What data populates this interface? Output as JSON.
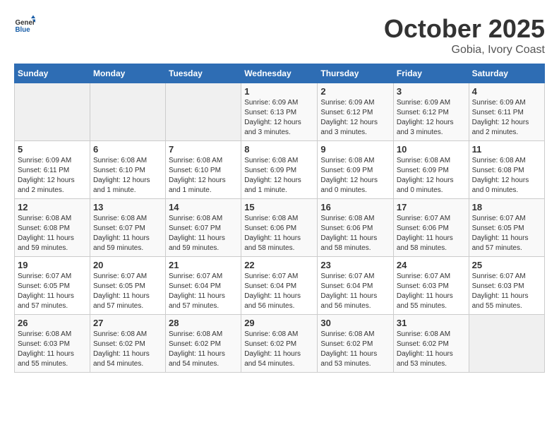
{
  "header": {
    "logo_general": "General",
    "logo_blue": "Blue",
    "month": "October 2025",
    "location": "Gobia, Ivory Coast"
  },
  "weekdays": [
    "Sunday",
    "Monday",
    "Tuesday",
    "Wednesday",
    "Thursday",
    "Friday",
    "Saturday"
  ],
  "weeks": [
    [
      {
        "day": "",
        "info": ""
      },
      {
        "day": "",
        "info": ""
      },
      {
        "day": "",
        "info": ""
      },
      {
        "day": "1",
        "info": "Sunrise: 6:09 AM\nSunset: 6:13 PM\nDaylight: 12 hours\nand 3 minutes."
      },
      {
        "day": "2",
        "info": "Sunrise: 6:09 AM\nSunset: 6:12 PM\nDaylight: 12 hours\nand 3 minutes."
      },
      {
        "day": "3",
        "info": "Sunrise: 6:09 AM\nSunset: 6:12 PM\nDaylight: 12 hours\nand 3 minutes."
      },
      {
        "day": "4",
        "info": "Sunrise: 6:09 AM\nSunset: 6:11 PM\nDaylight: 12 hours\nand 2 minutes."
      }
    ],
    [
      {
        "day": "5",
        "info": "Sunrise: 6:09 AM\nSunset: 6:11 PM\nDaylight: 12 hours\nand 2 minutes."
      },
      {
        "day": "6",
        "info": "Sunrise: 6:08 AM\nSunset: 6:10 PM\nDaylight: 12 hours\nand 1 minute."
      },
      {
        "day": "7",
        "info": "Sunrise: 6:08 AM\nSunset: 6:10 PM\nDaylight: 12 hours\nand 1 minute."
      },
      {
        "day": "8",
        "info": "Sunrise: 6:08 AM\nSunset: 6:09 PM\nDaylight: 12 hours\nand 1 minute."
      },
      {
        "day": "9",
        "info": "Sunrise: 6:08 AM\nSunset: 6:09 PM\nDaylight: 12 hours\nand 0 minutes."
      },
      {
        "day": "10",
        "info": "Sunrise: 6:08 AM\nSunset: 6:09 PM\nDaylight: 12 hours\nand 0 minutes."
      },
      {
        "day": "11",
        "info": "Sunrise: 6:08 AM\nSunset: 6:08 PM\nDaylight: 12 hours\nand 0 minutes."
      }
    ],
    [
      {
        "day": "12",
        "info": "Sunrise: 6:08 AM\nSunset: 6:08 PM\nDaylight: 11 hours\nand 59 minutes."
      },
      {
        "day": "13",
        "info": "Sunrise: 6:08 AM\nSunset: 6:07 PM\nDaylight: 11 hours\nand 59 minutes."
      },
      {
        "day": "14",
        "info": "Sunrise: 6:08 AM\nSunset: 6:07 PM\nDaylight: 11 hours\nand 59 minutes."
      },
      {
        "day": "15",
        "info": "Sunrise: 6:08 AM\nSunset: 6:06 PM\nDaylight: 11 hours\nand 58 minutes."
      },
      {
        "day": "16",
        "info": "Sunrise: 6:08 AM\nSunset: 6:06 PM\nDaylight: 11 hours\nand 58 minutes."
      },
      {
        "day": "17",
        "info": "Sunrise: 6:07 AM\nSunset: 6:06 PM\nDaylight: 11 hours\nand 58 minutes."
      },
      {
        "day": "18",
        "info": "Sunrise: 6:07 AM\nSunset: 6:05 PM\nDaylight: 11 hours\nand 57 minutes."
      }
    ],
    [
      {
        "day": "19",
        "info": "Sunrise: 6:07 AM\nSunset: 6:05 PM\nDaylight: 11 hours\nand 57 minutes."
      },
      {
        "day": "20",
        "info": "Sunrise: 6:07 AM\nSunset: 6:05 PM\nDaylight: 11 hours\nand 57 minutes."
      },
      {
        "day": "21",
        "info": "Sunrise: 6:07 AM\nSunset: 6:04 PM\nDaylight: 11 hours\nand 57 minutes."
      },
      {
        "day": "22",
        "info": "Sunrise: 6:07 AM\nSunset: 6:04 PM\nDaylight: 11 hours\nand 56 minutes."
      },
      {
        "day": "23",
        "info": "Sunrise: 6:07 AM\nSunset: 6:04 PM\nDaylight: 11 hours\nand 56 minutes."
      },
      {
        "day": "24",
        "info": "Sunrise: 6:07 AM\nSunset: 6:03 PM\nDaylight: 11 hours\nand 55 minutes."
      },
      {
        "day": "25",
        "info": "Sunrise: 6:07 AM\nSunset: 6:03 PM\nDaylight: 11 hours\nand 55 minutes."
      }
    ],
    [
      {
        "day": "26",
        "info": "Sunrise: 6:08 AM\nSunset: 6:03 PM\nDaylight: 11 hours\nand 55 minutes."
      },
      {
        "day": "27",
        "info": "Sunrise: 6:08 AM\nSunset: 6:02 PM\nDaylight: 11 hours\nand 54 minutes."
      },
      {
        "day": "28",
        "info": "Sunrise: 6:08 AM\nSunset: 6:02 PM\nDaylight: 11 hours\nand 54 minutes."
      },
      {
        "day": "29",
        "info": "Sunrise: 6:08 AM\nSunset: 6:02 PM\nDaylight: 11 hours\nand 54 minutes."
      },
      {
        "day": "30",
        "info": "Sunrise: 6:08 AM\nSunset: 6:02 PM\nDaylight: 11 hours\nand 53 minutes."
      },
      {
        "day": "31",
        "info": "Sunrise: 6:08 AM\nSunset: 6:02 PM\nDaylight: 11 hours\nand 53 minutes."
      },
      {
        "day": "",
        "info": ""
      }
    ]
  ]
}
